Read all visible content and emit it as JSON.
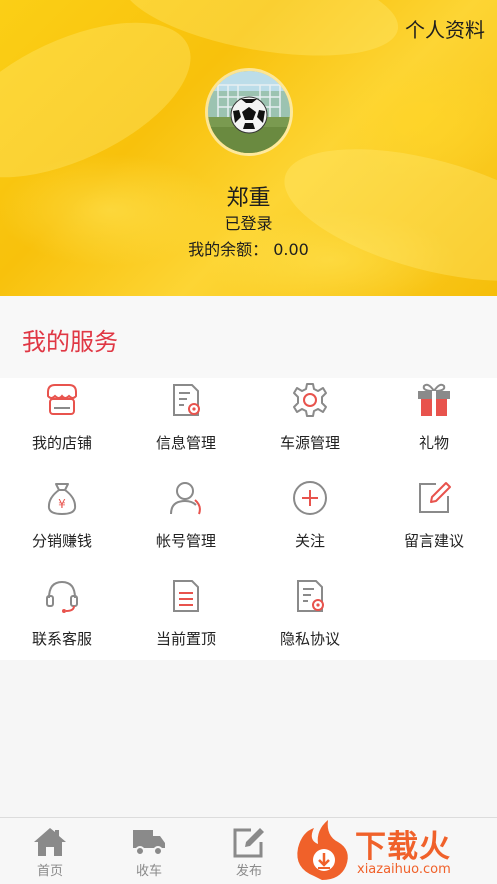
{
  "header": {
    "profile_link": "个人资料",
    "username": "郑重",
    "login_status": "已登录",
    "balance_label": "我的余额：",
    "balance_value": "0.00"
  },
  "services": {
    "title": "我的服务",
    "items": [
      {
        "label": "我的店铺",
        "icon": "shop-icon"
      },
      {
        "label": "信息管理",
        "icon": "document-gear-icon"
      },
      {
        "label": "车源管理",
        "icon": "gear-icon"
      },
      {
        "label": "礼物",
        "icon": "gift-icon"
      },
      {
        "label": "分销赚钱",
        "icon": "money-bag-icon"
      },
      {
        "label": "帐号管理",
        "icon": "user-icon"
      },
      {
        "label": "关注",
        "icon": "plus-circle-icon"
      },
      {
        "label": "留言建议",
        "icon": "edit-icon"
      },
      {
        "label": "联系客服",
        "icon": "headset-icon"
      },
      {
        "label": "当前置顶",
        "icon": "document-icon"
      },
      {
        "label": "隐私协议",
        "icon": "document-gear-icon"
      }
    ]
  },
  "tabbar": {
    "items": [
      {
        "label": "首页",
        "icon": "home-icon"
      },
      {
        "label": "收车",
        "icon": "truck-icon"
      },
      {
        "label": "发布",
        "icon": "edit-icon"
      }
    ]
  },
  "watermark": {
    "text": "下载火",
    "url": "xiazaihuo.com"
  },
  "colors": {
    "accent": "#e03744",
    "header_yellow": "#f8c10c",
    "icon_gray": "#8a8a8a",
    "icon_red": "#e8534d"
  }
}
